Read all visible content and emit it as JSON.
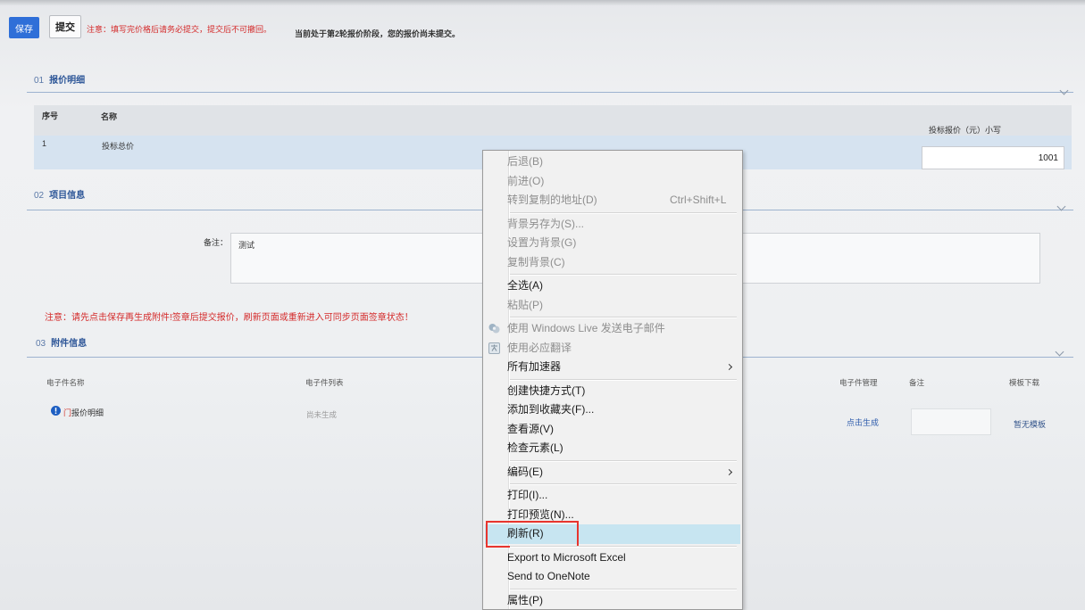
{
  "toolbar": {
    "save_label": "保存",
    "submit_label": "提交",
    "warning": "注意：填写完价格后请务必提交，提交后不可撤回。",
    "status": "当前处于第2轮报价阶段，您的报价尚未提交。"
  },
  "quote_section": {
    "number": "01",
    "title": "报价明细",
    "columns": {
      "index": "序号",
      "name": "名称",
      "price": "投标报价（元）小写"
    },
    "rows": [
      {
        "index": "1",
        "name": "投标总价",
        "price": "1001"
      }
    ]
  },
  "project_section": {
    "number": "02",
    "title": "项目信息",
    "remark_label": "备注：",
    "remark_value": "测试"
  },
  "notice": "注意：请先点击保存再生成附件!签章后提交报价，刷新页面或重新进入可同步页面签章状态！",
  "attachment_section": {
    "number": "03",
    "title": "附件信息",
    "columns": {
      "name": "电子件名称",
      "list": "电子件列表",
      "manage": "电子件管理",
      "remark": "备注",
      "template": "模板下载"
    },
    "rows": [
      {
        "name": "门报价明细",
        "list": "尚未生成",
        "manage": "点击生成",
        "remark": "",
        "template": "暂无模板"
      }
    ]
  },
  "context_menu": {
    "items": [
      {
        "label": "后退(B)",
        "enabled": false
      },
      {
        "label": "前进(O)",
        "enabled": false
      },
      {
        "label": "转到复制的地址(D)",
        "shortcut": "Ctrl+Shift+L",
        "enabled": false
      },
      {
        "label": "背景另存为(S)...",
        "enabled": false
      },
      {
        "label": "设置为背景(G)",
        "enabled": false
      },
      {
        "label": "复制背景(C)",
        "enabled": false
      },
      {
        "label": "全选(A)",
        "enabled": true
      },
      {
        "label": "粘贴(P)",
        "enabled": false
      },
      {
        "label": "使用 Windows Live 发送电子邮件",
        "enabled": false,
        "icon": "windows-live-mail-icon"
      },
      {
        "label": "使用必应翻译",
        "enabled": false,
        "icon": "bing-translate-icon"
      },
      {
        "label": "所有加速器",
        "enabled": true,
        "submenu": true
      },
      {
        "label": "创建快捷方式(T)",
        "enabled": true
      },
      {
        "label": "添加到收藏夹(F)...",
        "enabled": true
      },
      {
        "label": "查看源(V)",
        "enabled": true
      },
      {
        "label": "检查元素(L)",
        "enabled": true
      },
      {
        "label": "编码(E)",
        "enabled": true,
        "submenu": true
      },
      {
        "label": "打印(I)...",
        "enabled": true
      },
      {
        "label": "打印预览(N)...",
        "enabled": true
      },
      {
        "label": "刷新(R)",
        "enabled": true,
        "highlighted": true,
        "outlined_in_red": true
      },
      {
        "label": "Export to Microsoft Excel",
        "enabled": true
      },
      {
        "label": "Send to OneNote",
        "enabled": true
      },
      {
        "label": "属性(P)",
        "enabled": true
      }
    ]
  },
  "colors": {
    "primary": "#2f6fd8",
    "warning_text": "#d42a2a",
    "section_title": "#2c5597",
    "section_line": "#9db3cf",
    "row_highlight": "#d6e3f0",
    "menu_hover": "#c7e5f1",
    "annotation_box": "#e8352e",
    "link": "#2d5bab"
  },
  "icons": {
    "section_toggle": "chevron-down-icon",
    "attachment_status": "info-icon",
    "submenu": "chevron-right-icon",
    "windows_live": "windows-live-mail-icon",
    "bing_translate": "bing-translate-icon"
  }
}
